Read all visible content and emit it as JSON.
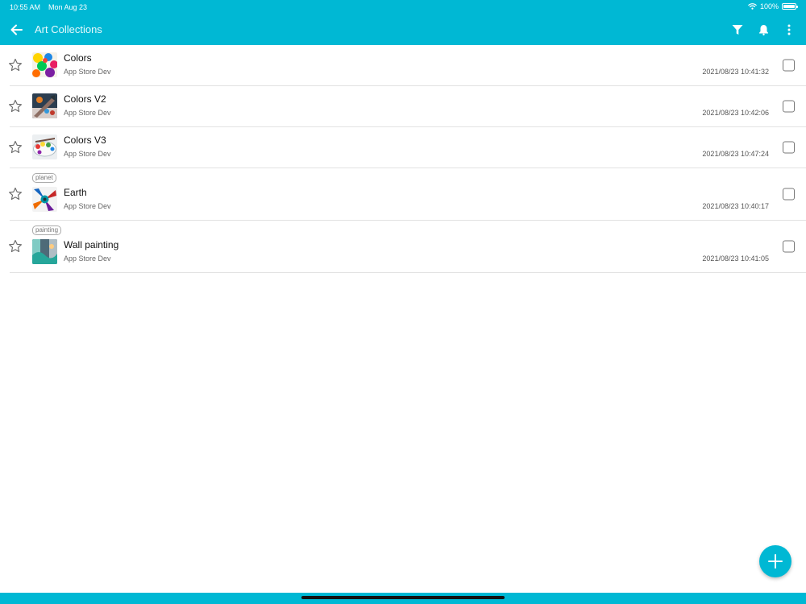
{
  "status": {
    "time": "10:55 AM",
    "date": "Mon Aug 23",
    "battery": "100%",
    "battery_level": 1.0
  },
  "header": {
    "title": "Art Collections",
    "icons": [
      "back-arrow-icon",
      "filter-icon",
      "bell-icon",
      "more-vert-icon"
    ]
  },
  "colors": {
    "accent": "#00b8d4",
    "divider": "#e2e2e2"
  },
  "items": [
    {
      "name": "Colors",
      "author": "App Store Dev",
      "timestamp": "2021/08/23 10:41:32",
      "tag": "",
      "starred": false,
      "checked": false
    },
    {
      "name": "Colors V2",
      "author": "App Store Dev",
      "timestamp": "2021/08/23 10:42:06",
      "tag": "",
      "starred": false,
      "checked": false
    },
    {
      "name": "Colors V3",
      "author": "App Store Dev",
      "timestamp": "2021/08/23 10:47:24",
      "tag": "",
      "starred": false,
      "checked": false
    },
    {
      "name": "Earth",
      "author": "App Store Dev",
      "timestamp": "2021/08/23 10:40:17",
      "tag": "planet",
      "starred": false,
      "checked": false
    },
    {
      "name": "Wall painting",
      "author": "App Store Dev",
      "timestamp": "2021/08/23 10:41:05",
      "tag": "painting",
      "starred": false,
      "checked": false
    }
  ],
  "fab": {
    "icon": "plus-icon"
  }
}
